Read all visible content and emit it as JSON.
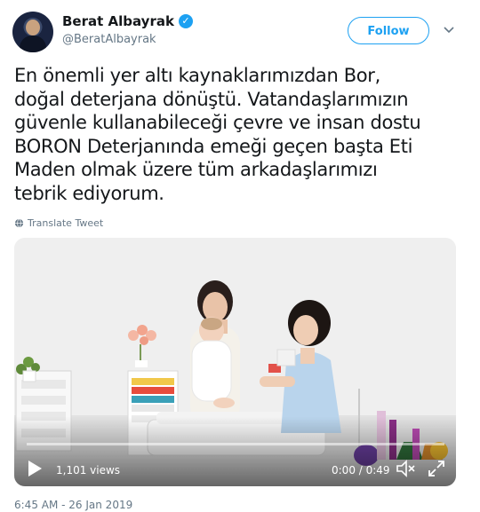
{
  "tweet": {
    "display_name": "Berat Albayrak",
    "handle": "@BeratAlbayrak",
    "follow_label": "Follow",
    "text_lines": [
      "En önemli yer altı kaynaklarımızdan Bor,",
      "doğal deterjana dönüştü. Vatandaşlarımızın",
      "güvenle kullanabileceği çevre ve insan dostu",
      "BORON Deterjanında emeği geçen başta Eti",
      "Maden olmak üzere tüm arkadaşlarımızı",
      "tebrik ediyorum."
    ],
    "translate_label": "Translate Tweet",
    "timestamp": "6:45 AM - 26 Jan 2019"
  },
  "video": {
    "views": "1,101 views",
    "time": "0:00 / 0:49",
    "progress": 0
  },
  "icons": {
    "verified": "verified-badge-icon",
    "caret": "chevron-down-icon",
    "globe": "globe-icon",
    "play": "play-icon",
    "volume": "volume-muted-icon",
    "fullscreen": "fullscreen-icon"
  },
  "colors": {
    "accent": "#1da1f2",
    "text": "#14171a",
    "secondary": "#657786"
  }
}
